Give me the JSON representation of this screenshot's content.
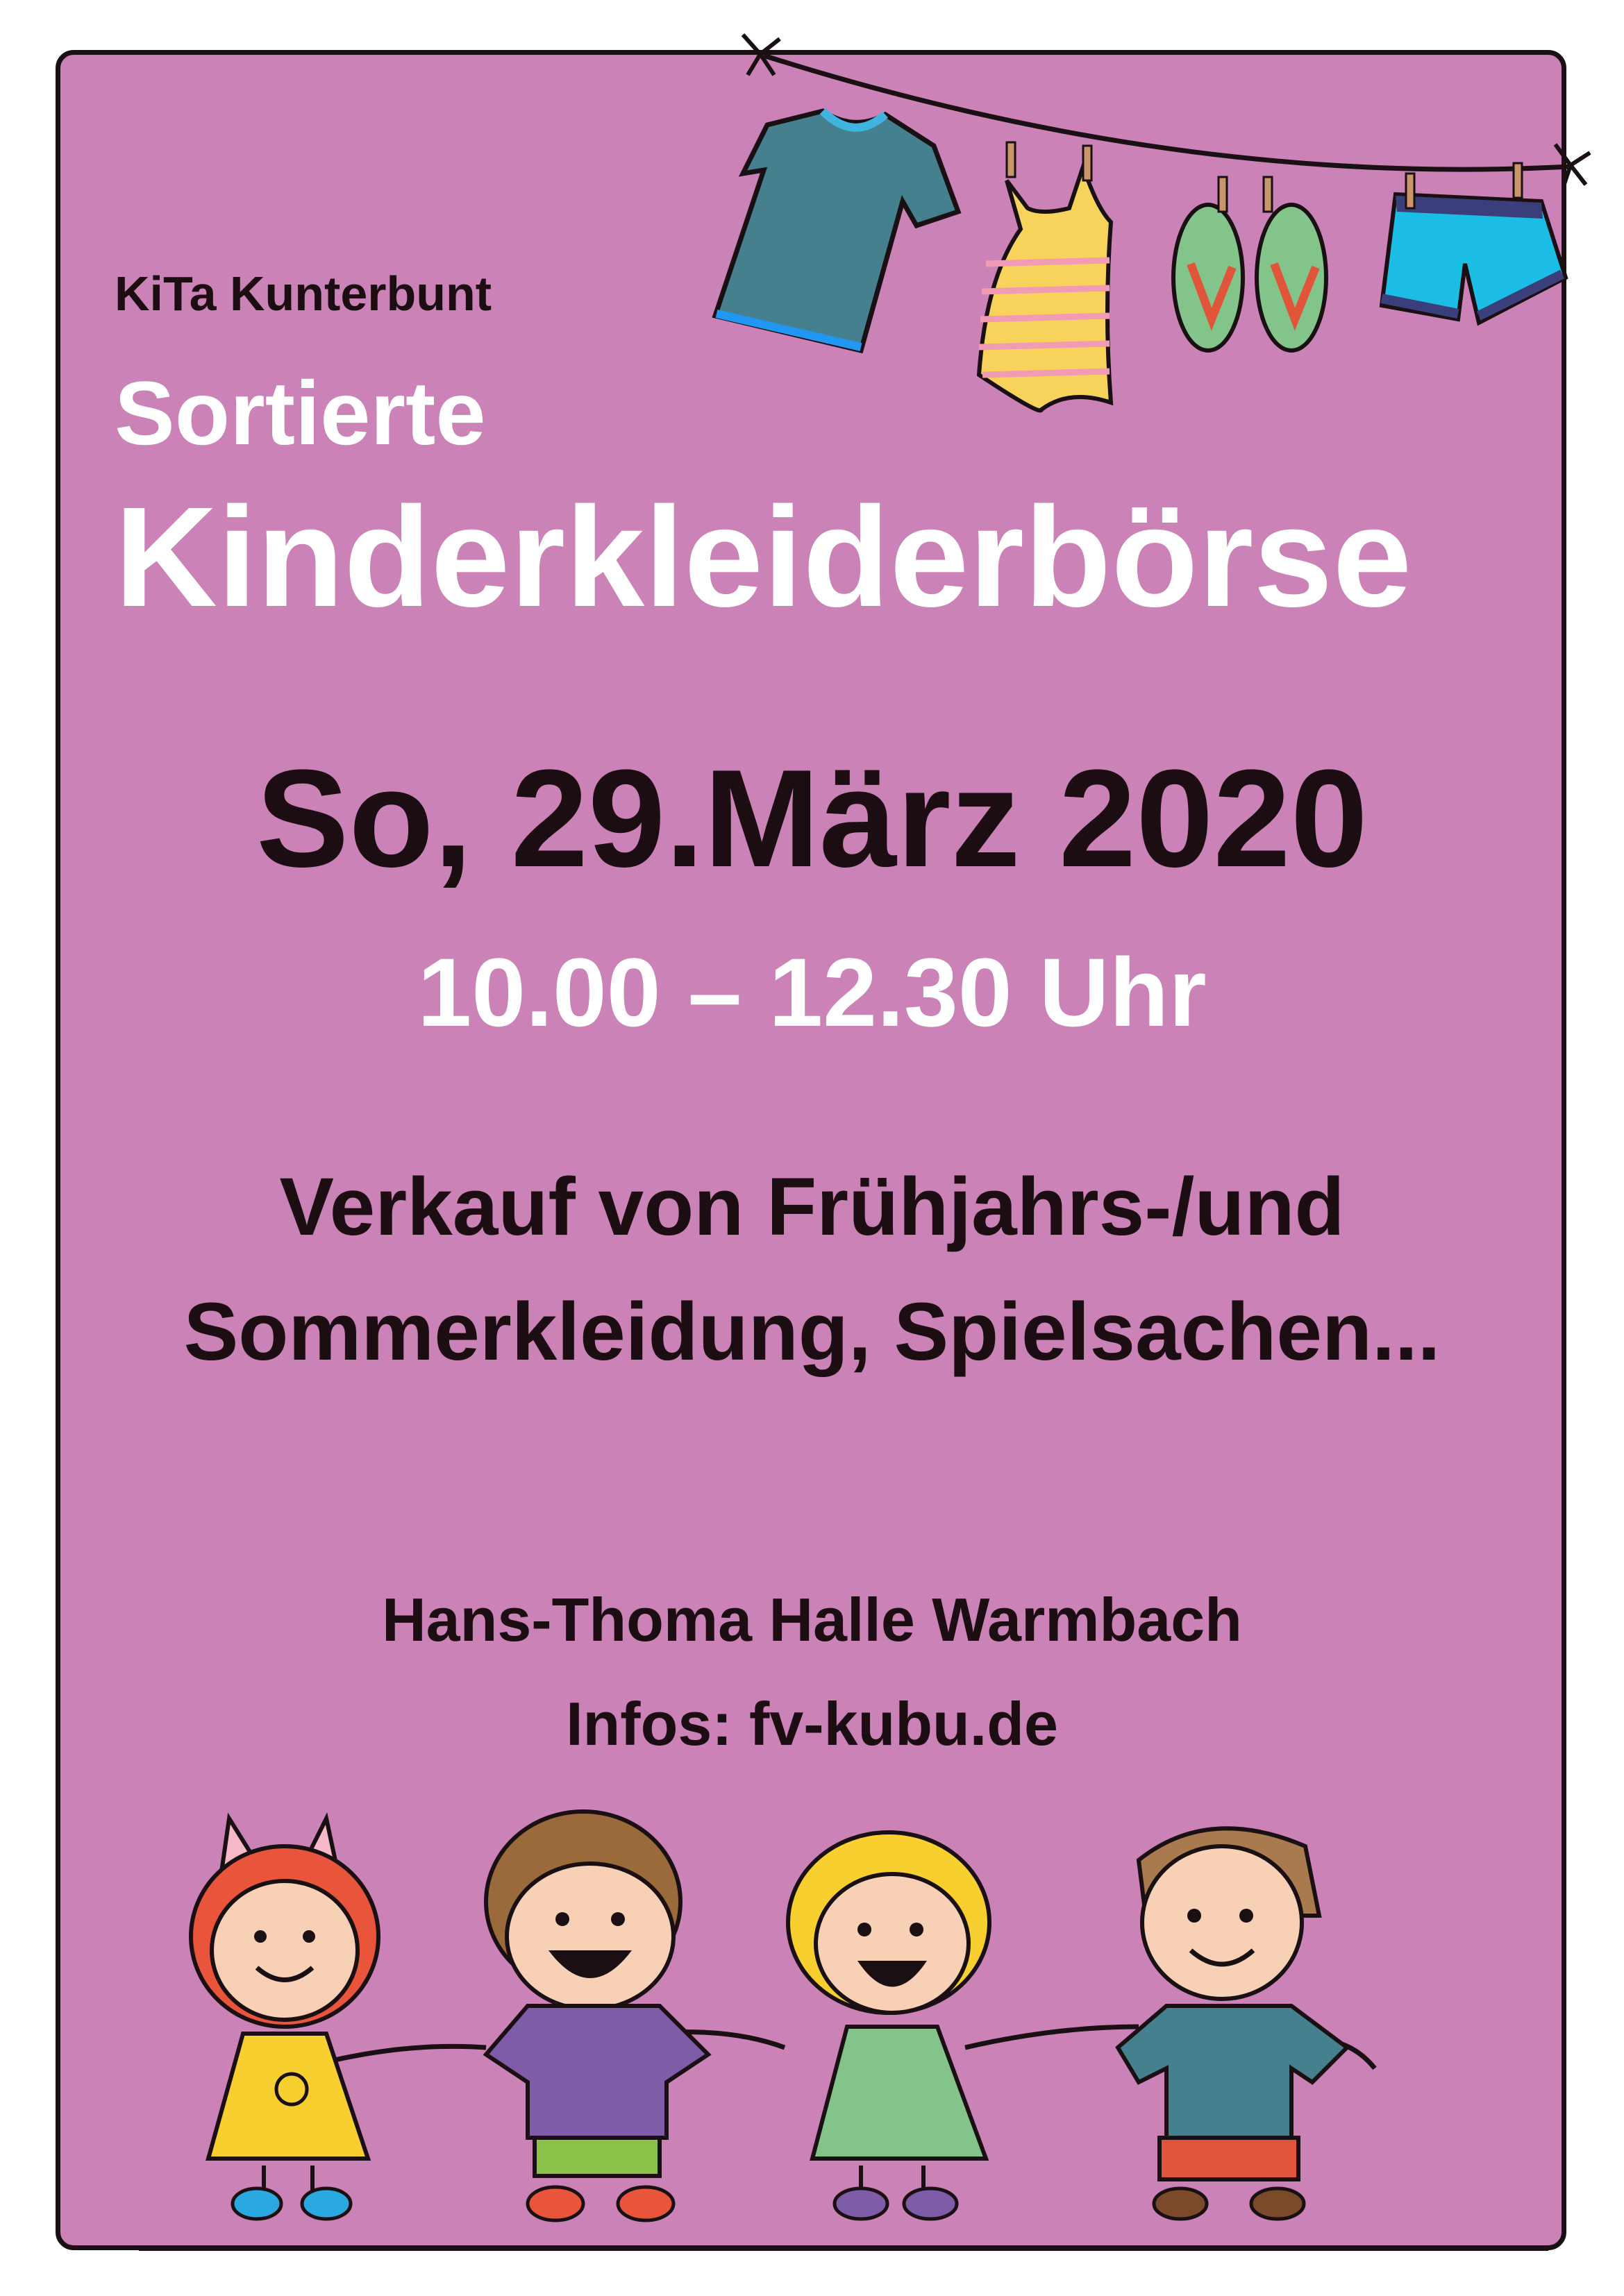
{
  "poster": {
    "organizer": "KiTa Kunterbunt",
    "subtitle": "Sortierte",
    "title": "Kinderkleiderbörse",
    "date": "So, 29.März 2020",
    "time": "10.00 – 12.30 Uhr",
    "description_line1": "Verkauf von Frühjahrs-/und",
    "description_line2": "Sommerkleidung, Spielsachen...",
    "venue": "Hans-Thoma Halle Warmbach",
    "info": "Infos: fv-kubu.de"
  },
  "colors": {
    "background": "#cb82b6",
    "title_text": "#ffffff",
    "body_text": "#1c0d12"
  },
  "illustrations": {
    "clothesline_items": [
      "t-shirt",
      "swimsuit",
      "flip-flops",
      "swim-shorts"
    ],
    "children": [
      "girl-yellow-dress",
      "boy-purple-shirt",
      "girl-green-dress",
      "boy-teal-shirt"
    ]
  }
}
